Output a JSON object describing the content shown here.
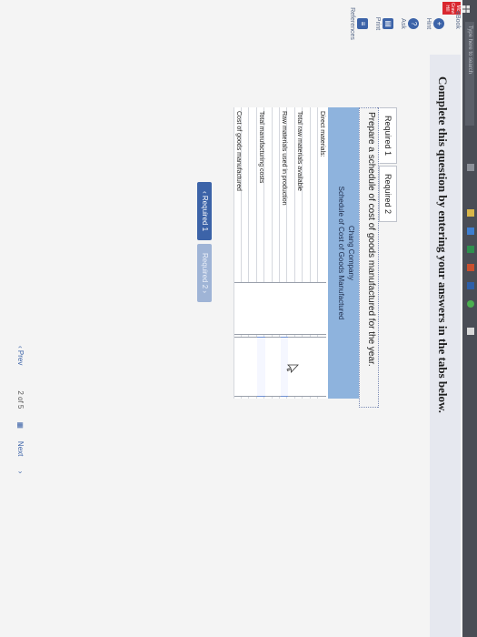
{
  "sidebar": {
    "ebook_label": "eBook",
    "tools": [
      {
        "label": "Hint",
        "icon": "lifebuoy-icon"
      },
      {
        "label": "Ask",
        "icon": "chat-bubble-icon"
      },
      {
        "label": "Print",
        "icon": "printer-icon"
      },
      {
        "label": "References",
        "icon": "references-icon"
      }
    ],
    "logo_text": "Mc Graw Hill"
  },
  "header": {
    "title": "Complete this question by entering your answers in the tabs below."
  },
  "tabs": [
    {
      "label": "Required 1",
      "active": true
    },
    {
      "label": "Required 2",
      "active": false
    }
  ],
  "instruction": "Prepare a schedule of cost of goods manufactured for the year.",
  "statement": {
    "company": "Chang Company",
    "title": "Schedule of Cost of Goods Manufactured",
    "rows": [
      {
        "label": "Direct materials:",
        "indent": false
      },
      {
        "label": "",
        "indent": true
      },
      {
        "label": "",
        "indent": true
      },
      {
        "label": "Total raw materials available",
        "indent": false
      },
      {
        "label": "",
        "indent": true
      },
      {
        "label": "Raw materials used in production",
        "indent": false
      },
      {
        "label": "",
        "indent": true
      },
      {
        "label": "",
        "indent": true
      },
      {
        "label": "Total manufacturing costs",
        "indent": false
      },
      {
        "label": "",
        "indent": true
      },
      {
        "label": "",
        "indent": true
      },
      {
        "label": "Cost of goods manufactured",
        "indent": false
      }
    ]
  },
  "nav": {
    "prev_required": "Required 1",
    "next_required": "Required 2"
  },
  "pager": {
    "prev": "Prev",
    "count": "2 of 5",
    "next": "Next"
  },
  "taskbar": {
    "search_placeholder": "Type here to search"
  }
}
